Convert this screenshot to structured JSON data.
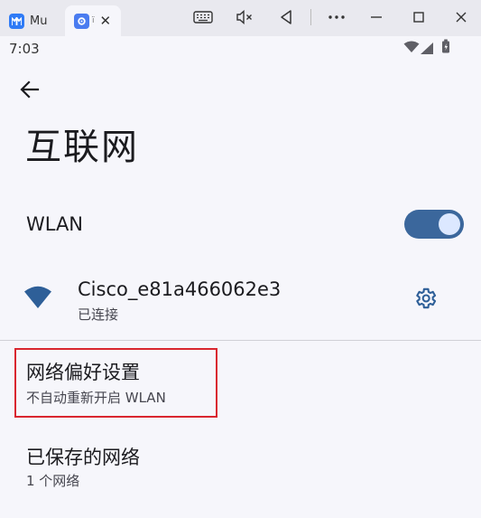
{
  "window": {
    "tabs": [
      {
        "label": "Mu"
      },
      {
        "label": "ï"
      }
    ]
  },
  "status_bar": {
    "time": "7:03"
  },
  "page": {
    "title": "互联网"
  },
  "wlan": {
    "label": "WLAN",
    "enabled": true,
    "accent_color": "#3b679c"
  },
  "network": {
    "name": "Cisco_e81a466062e3",
    "status": "已连接",
    "icon": "wifi-icon"
  },
  "preferences": {
    "title": "网络偏好设置",
    "subtitle": "不自动重新开启 WLAN"
  },
  "saved_networks": {
    "title": "已保存的网络",
    "subtitle": "1 个网络"
  },
  "highlight_color": "#d9262f"
}
